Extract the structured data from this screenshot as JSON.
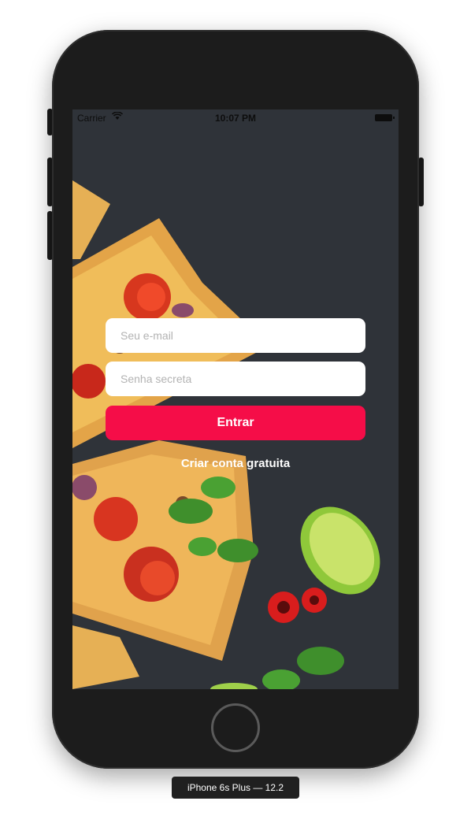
{
  "status_bar": {
    "carrier": "Carrier",
    "time": "10:07 PM"
  },
  "login_form": {
    "email_placeholder": "Seu e-mail",
    "password_placeholder": "Senha secreta",
    "submit_label": "Entrar",
    "signup_label": "Criar conta gratuita"
  },
  "device": {
    "label": "iPhone 6s Plus — 12.2"
  },
  "colors": {
    "accent": "#f50d48",
    "background": "#2c3035"
  },
  "icons": [
    "wifi-icon",
    "battery-icon"
  ]
}
